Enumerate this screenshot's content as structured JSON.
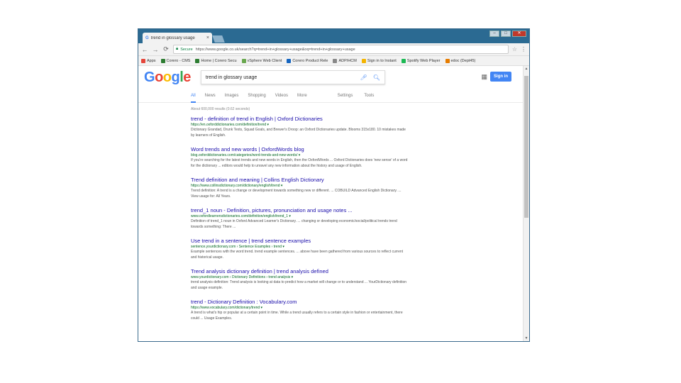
{
  "browser": {
    "tab_title": "trend in glossary usage",
    "tab_close": "×",
    "window_controls": [
      "–",
      "□",
      "✕"
    ],
    "secure_label": "Secure",
    "url": "https://www.google.co.uk/search?q=trend+in+glossary+usage&oq=trend+in+glossary+usage",
    "bookmarks": [
      {
        "label": "Apps",
        "color": "#e5463b"
      },
      {
        "label": "Corero - CMS",
        "color": "#2e7d32"
      },
      {
        "label": "Home | Corero Secu",
        "color": "#2e7d32"
      },
      {
        "label": "vSphere Web Client",
        "color": "#6aa84f"
      },
      {
        "label": "Corero Product Rele",
        "color": "#1565c0"
      },
      {
        "label": "ADP/HCM",
        "color": "#888888"
      },
      {
        "label": "Sign in to Instant",
        "color": "#f4b400"
      },
      {
        "label": "Spotify Web Player",
        "color": "#1db954"
      },
      {
        "label": "edoc (Dept45)",
        "color": "#e67c00"
      }
    ]
  },
  "google": {
    "query": "trend in glossary usage",
    "signin": "Sign in",
    "tabs": [
      "All",
      "News",
      "Images",
      "Shopping",
      "Videos",
      "More"
    ],
    "tools": [
      "Settings",
      "Tools"
    ],
    "stats": "About 600,000 results (0.62 seconds)"
  },
  "results": [
    {
      "title": "trend - definition of trend in English | Oxford Dictionaries",
      "url": "https://en.oxforddictionaries.com/definition/trend ▾",
      "snippet": "Dictionary Grandad, Drunk Texts, Squad Goals, and Brewer's Droop: an Oxford Dictionaries update. Blooms 315x180. 10 mistakes made by learners of English."
    },
    {
      "title": "Word trends and new words | OxfordWords blog",
      "url": "blog.oxforddictionaries.com/categories/word-trends-and-new-words/ ▾",
      "snippet": "If you're searching for the latest trends and new words in English, then the OxfordWords ... Oxford Dictionaries does 'new sense' of a word for the dictionary ... editors would help to unravel any new information about the history and usage of English."
    },
    {
      "title": "Trend definition and meaning | Collins English Dictionary",
      "url": "https://www.collinsdictionary.com/dictionary/english/trend ▾",
      "snippet": "Trend definition: A trend is a change or development towards something new or different. ... COBUILD Advanced English Dictionary. ... View usage for: All Years."
    },
    {
      "title": "trend_1 noun - Definition, pictures, pronunciation and usage notes ...",
      "url": "www.oxfordlearnersdictionaries.com/definition/english/trend_1 ▾",
      "snippet": "Definition of trend_1 noun in Oxford Advanced Learner's Dictionary. ... changing or developing economic/social/political trends trend towards something: There ..."
    },
    {
      "title": "Use trend in a sentence | trend sentence examples",
      "url": "sentence.yourdictionary.com › Sentence Examples › trend ▾",
      "snippet": "Example sentences with the word trend. trend example sentences. ... above have been gathered from various sources to reflect current and historical usage."
    },
    {
      "title": "Trend analysis dictionary definition | trend analysis defined",
      "url": "www.yourdictionary.com › Dictionary Definitions › trend analysis ▾",
      "snippet": "trend analysis definition: Trend analysis is looking at data to predict how a market will change or to understand ... YourDictionary definition and usage example."
    },
    {
      "title": "trend - Dictionary Definition : Vocabulary.com",
      "url": "https://www.vocabulary.com/dictionary/trend ▾",
      "snippet": "A trend is what's hip or popular at a certain point in time. While a trend usually refers to a certain style in fashion or entertainment, there could ... Usage Examples."
    }
  ]
}
